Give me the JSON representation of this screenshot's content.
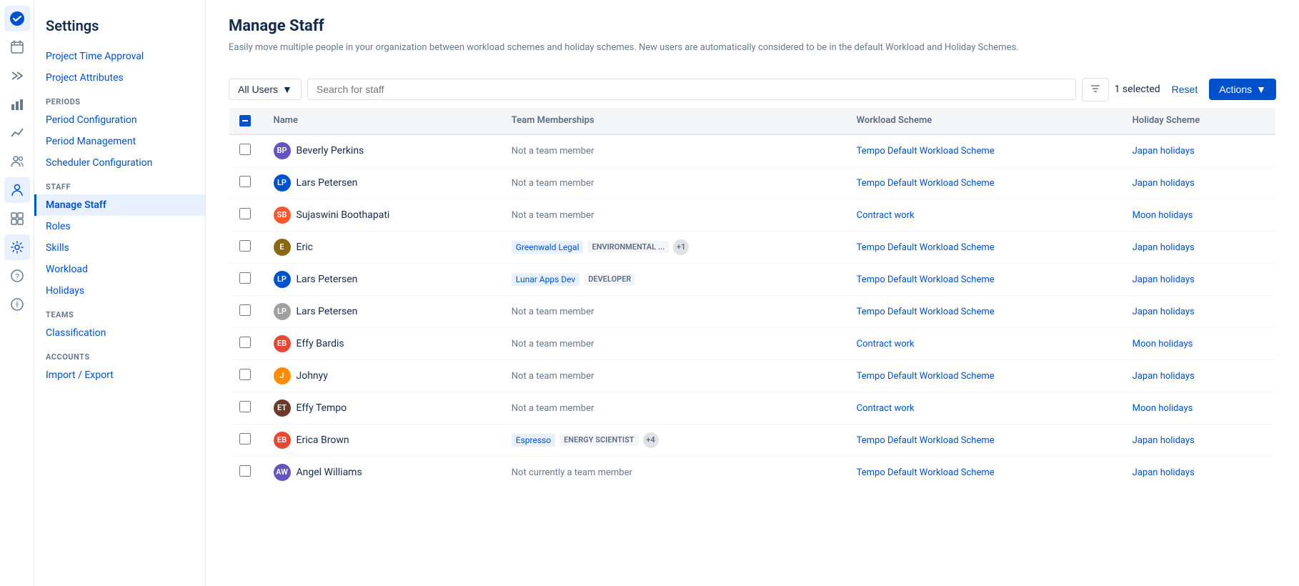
{
  "app": {
    "title": "Settings"
  },
  "sidebar": {
    "title": "Settings",
    "items": [
      {
        "id": "project-time-approval",
        "label": "Project Time Approval",
        "section": null,
        "active": false
      },
      {
        "id": "project-attributes",
        "label": "Project Attributes",
        "section": null,
        "active": false
      },
      {
        "id": "period-configuration",
        "label": "Period Configuration",
        "section": "PERIODS",
        "active": false
      },
      {
        "id": "period-management",
        "label": "Period Management",
        "section": null,
        "active": false
      },
      {
        "id": "scheduler-configuration",
        "label": "Scheduler Configuration",
        "section": null,
        "active": false
      },
      {
        "id": "manage-staff",
        "label": "Manage Staff",
        "section": "STAFF",
        "active": true
      },
      {
        "id": "roles",
        "label": "Roles",
        "section": null,
        "active": false
      },
      {
        "id": "skills",
        "label": "Skills",
        "section": null,
        "active": false
      },
      {
        "id": "workload",
        "label": "Workload",
        "section": null,
        "active": false
      },
      {
        "id": "holidays",
        "label": "Holidays",
        "section": null,
        "active": false
      },
      {
        "id": "classification",
        "label": "Classification",
        "section": "TEAMS",
        "active": false
      },
      {
        "id": "import-export",
        "label": "Import / Export",
        "section": "ACCOUNTS",
        "active": false
      }
    ]
  },
  "page": {
    "title": "Manage Staff",
    "subtitle": "Easily move multiple people in your organization between workload schemes and holiday schemes. New users are automatically considered to be in the default Workload and Holiday Schemes."
  },
  "toolbar": {
    "all_users_label": "All Users",
    "search_placeholder": "Search for staff",
    "selected_text": "1 selected",
    "reset_label": "Reset",
    "actions_label": "Actions"
  },
  "table": {
    "headers": [
      "",
      "Name",
      "Team Memberships",
      "Workload Scheme",
      "Holiday Scheme"
    ],
    "rows": [
      {
        "id": 1,
        "name": "Beverly Perkins",
        "avatar_color": "#6554c0",
        "avatar_initials": "BP",
        "team_memberships": "Not a team member",
        "team_badge": null,
        "role_badge": null,
        "plus_count": null,
        "workload": "Tempo Default Workload Scheme",
        "holiday": "Japan holidays",
        "checked": false
      },
      {
        "id": 2,
        "name": "Lars Petersen",
        "avatar_color": "#0052cc",
        "avatar_initials": "LP",
        "team_memberships": "Not a team member",
        "team_badge": null,
        "role_badge": null,
        "plus_count": null,
        "workload": "Tempo Default Workload Scheme",
        "holiday": "Japan holidays",
        "checked": false
      },
      {
        "id": 3,
        "name": "Sujaswini Boothapati",
        "avatar_color": "#ff5630",
        "avatar_initials": "SB",
        "team_memberships": "Not a team member",
        "team_badge": null,
        "role_badge": null,
        "plus_count": null,
        "workload": "Contract work",
        "holiday": "Moon holidays",
        "checked": false
      },
      {
        "id": 4,
        "name": "Eric",
        "avatar_color": "#8b6914",
        "avatar_initials": "E",
        "team_memberships": "Greenwald Legal",
        "team_badge": "Greenwald Legal",
        "role_badge": "ENVIRONMENTAL ...",
        "plus_count": "+1",
        "workload": "Tempo Default Workload Scheme",
        "holiday": "Japan holidays",
        "checked": false
      },
      {
        "id": 5,
        "name": "Lars Petersen",
        "avatar_color": "#0052cc",
        "avatar_initials": "LP",
        "team_memberships": "Lunar Apps Dev",
        "team_badge": "Lunar Apps Dev",
        "role_badge": "DEVELOPER",
        "plus_count": null,
        "workload": "Tempo Default Workload Scheme",
        "holiday": "Japan holidays",
        "checked": false
      },
      {
        "id": 6,
        "name": "Lars Petersen",
        "avatar_color": "#a0a0a0",
        "avatar_initials": "LP",
        "team_memberships": "Not a team member",
        "team_badge": null,
        "role_badge": null,
        "plus_count": null,
        "workload": "Tempo Default Workload Scheme",
        "holiday": "Japan holidays",
        "checked": false
      },
      {
        "id": 7,
        "name": "Effy Bardis",
        "avatar_color": "#e34935",
        "avatar_initials": "EB",
        "team_memberships": "Not a team member",
        "team_badge": null,
        "role_badge": null,
        "plus_count": null,
        "workload": "Contract work",
        "holiday": "Moon holidays",
        "checked": false
      },
      {
        "id": 8,
        "name": "Johnyy",
        "avatar_color": "#ff8b00",
        "avatar_initials": "J",
        "team_memberships": "Not a team member",
        "team_badge": null,
        "role_badge": null,
        "plus_count": null,
        "workload": "Tempo Default Workload Scheme",
        "holiday": "Japan holidays",
        "checked": false
      },
      {
        "id": 9,
        "name": "Effy Tempo",
        "avatar_color": "#6b3a2a",
        "avatar_initials": "ET",
        "team_memberships": "Not a team member",
        "team_badge": null,
        "role_badge": null,
        "plus_count": null,
        "workload": "Contract work",
        "holiday": "Moon holidays",
        "checked": false
      },
      {
        "id": 10,
        "name": "Erica Brown",
        "avatar_color": "#e34935",
        "avatar_initials": "EB",
        "team_memberships": "Espresso",
        "team_badge": "Espresso",
        "role_badge": "ENERGY SCIENTIST",
        "plus_count": "+4",
        "workload": "Tempo Default Workload Scheme",
        "holiday": "Japan holidays",
        "checked": false
      },
      {
        "id": 11,
        "name": "Angel Williams",
        "avatar_color": "#6554c0",
        "avatar_initials": "AW",
        "team_memberships": "Not currently a team member",
        "team_badge": null,
        "role_badge": null,
        "plus_count": null,
        "workload": "Tempo Default Workload Scheme",
        "holiday": "Japan holidays",
        "checked": false
      }
    ]
  },
  "icons": {
    "checkmark": "✓",
    "chevron_down": "▼",
    "filter": "⊟",
    "calendar": "📅",
    "users": "👥",
    "chart": "📊",
    "gear": "⚙",
    "help": "?",
    "lightning": "⚡",
    "home": "🏠"
  }
}
